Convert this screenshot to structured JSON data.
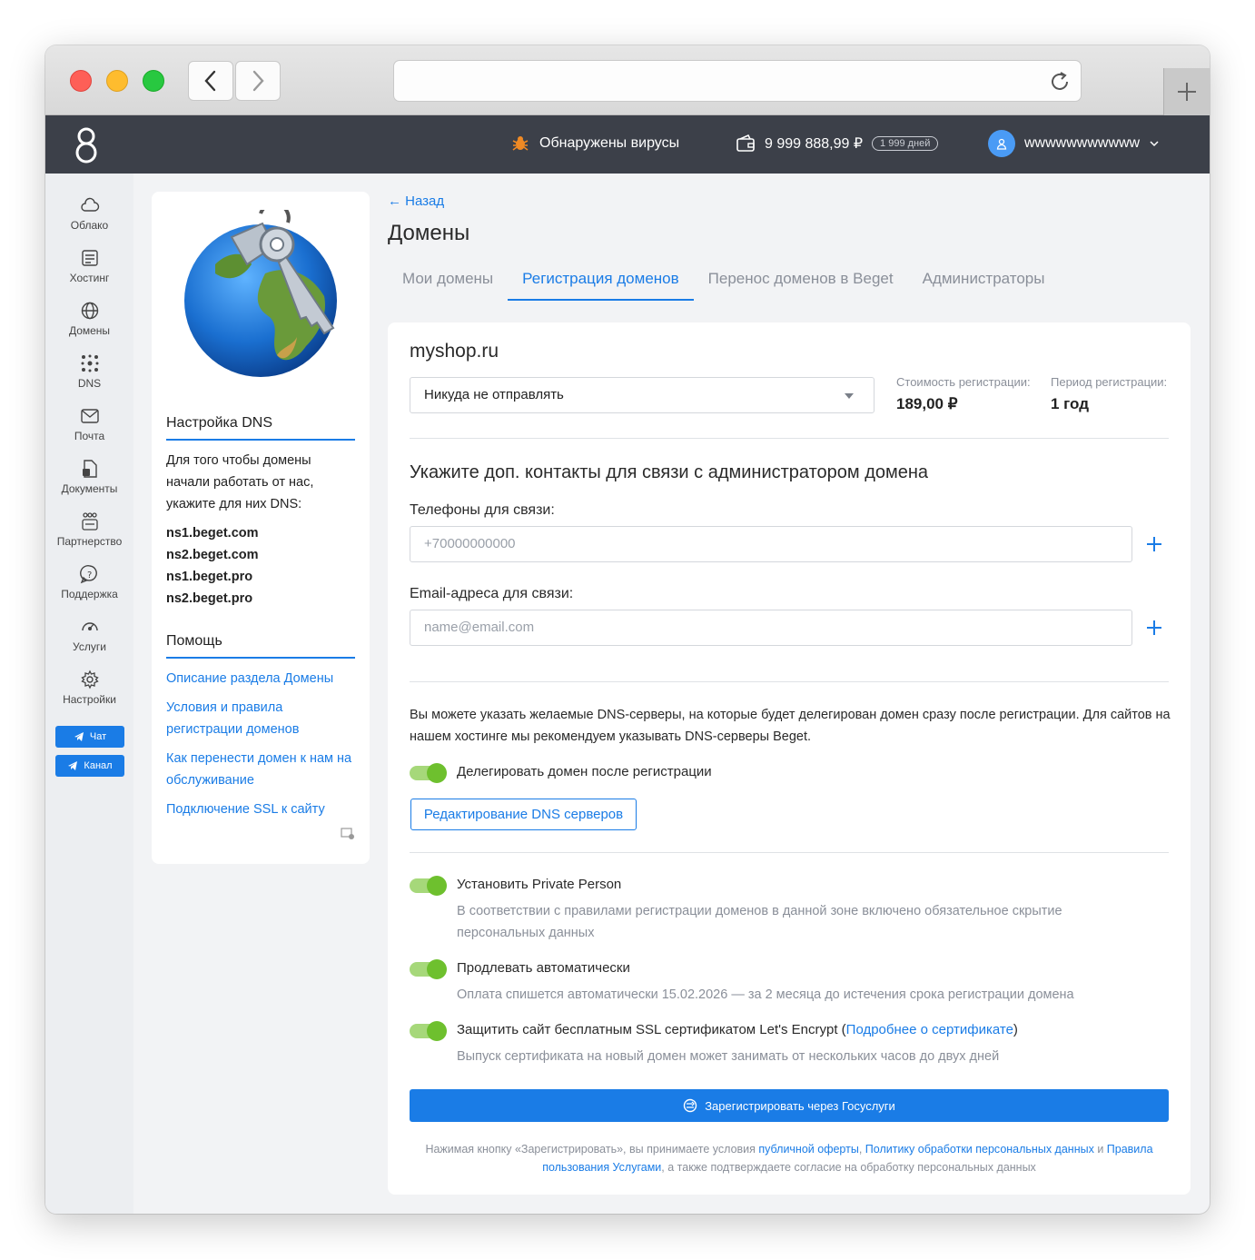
{
  "topbar": {
    "virus_text": "Обнаружены вирусы",
    "balance": "9 999 888,99 ₽",
    "days": "1 999 дней",
    "username": "wwwwwwwwwww"
  },
  "sidebar": {
    "items": [
      {
        "label": "Облако",
        "icon": "cloud-icon"
      },
      {
        "label": "Хостинг",
        "icon": "hosting-icon"
      },
      {
        "label": "Домены",
        "icon": "globe-icon"
      },
      {
        "label": "DNS",
        "icon": "dns-icon"
      },
      {
        "label": "Почта",
        "icon": "mail-icon"
      },
      {
        "label": "Документы",
        "icon": "documents-icon"
      },
      {
        "label": "Партнерство",
        "icon": "partnership-icon"
      },
      {
        "label": "Поддержка",
        "icon": "support-icon"
      },
      {
        "label": "Услуги",
        "icon": "services-icon"
      },
      {
        "label": "Настройки",
        "icon": "gear-icon"
      }
    ],
    "chat_label": "Чат",
    "channel_label": "Канал"
  },
  "left_card": {
    "dns_title": "Настройка DNS",
    "dns_text": "Для того чтобы домены начали работать от нас, укажите для них DNS:",
    "ns": [
      "ns1.beget.com",
      "ns2.beget.com",
      "ns1.beget.pro",
      "ns2.beget.pro"
    ],
    "help_title": "Помощь",
    "help_links": [
      "Описание раздела Домены",
      "Условия и правила регистрации доменов",
      "Как перенести домен к нам на обслуживание",
      "Подключение SSL к сайту"
    ]
  },
  "main": {
    "back": "Назад",
    "title": "Домены",
    "tabs": [
      "Мои домены",
      "Регистрация доменов",
      "Перенос доменов в Beget",
      "Администраторы"
    ],
    "active_tab": 1
  },
  "form": {
    "domain": "myshop.ru",
    "select_value": "Никуда не отправлять",
    "cost_label": "Стоимость регистрации:",
    "cost_value": "189,00 ₽",
    "period_label": "Период регистрации:",
    "period_value": "1 год",
    "contacts_title": "Укажите доп. контакты для связи с администратором домена",
    "phones_label": "Телефоны для связи:",
    "phone_placeholder": "+70000000000",
    "emails_label": "Email-адреса для связи:",
    "email_placeholder": "name@email.com",
    "dns_paragraph": "Вы можете указать желаемые DNS-серверы, на которые будет делегирован домен сразу после регистрации. Для сайтов на нашем хостинге мы рекомендуем указывать DNS-серверы Beget.",
    "delegate_label": "Делегировать домен после регистрации",
    "edit_dns_button": "Редактирование DNS серверов",
    "private_label": "Установить Private Person",
    "private_desc": "В соответствии с правилами регистрации доменов в данной зоне включено обязательное скрытие персональных данных",
    "autorenew_label": "Продлевать автоматически",
    "autorenew_desc": "Оплата спишется автоматически 15.02.2026 — за 2 месяца до истечения срока регистрации домена",
    "ssl_label_pre": "Защитить сайт бесплатным SSL сертификатом Let's Encrypt (",
    "ssl_link": "Подробнее о сертификате",
    "ssl_label_post": ")",
    "ssl_desc": "Выпуск сертификата на новый домен может занимать от нескольких часов до двух дней",
    "submit_button": "Зарегистрировать через Госуслуги",
    "legal_1": "Нажимая кнопку «Зарегистрировать», вы принимаете условия ",
    "legal_link_1": "публичной оферты",
    "legal_2": ", ",
    "legal_link_2": "Политику обработки персональных данных",
    "legal_3": " и ",
    "legal_link_3": "Правила пользования Услугами",
    "legal_4": ", а также подтверждаете согласие на обработку персональных данных"
  },
  "colors": {
    "accent": "#1a7ce6",
    "topbar": "#3c4049",
    "toggle_on": "#6ec02e"
  }
}
